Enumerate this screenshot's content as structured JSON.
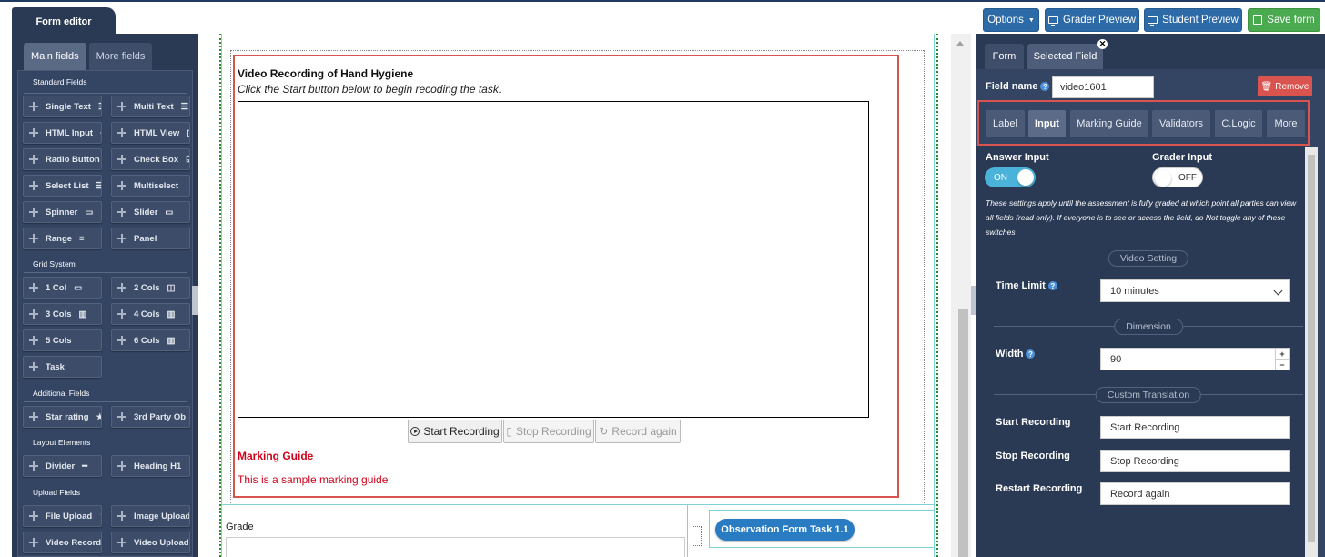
{
  "topbar": {
    "tab_label": "Form editor",
    "options_label": "Options",
    "grader_preview_label": "Grader Preview",
    "student_preview_label": "Student Preview",
    "save_label": "Save form",
    "colors": {
      "blue": "#2c6aa8",
      "green": "#4aaa4f",
      "navy": "#2a3a55"
    }
  },
  "left": {
    "tabs": [
      "Main fields",
      "More fields"
    ],
    "groups": {
      "standard": "Standard Fields",
      "grid": "Grid System",
      "additional": "Additional Fields",
      "layout": "Layout Elements",
      "upload": "Upload Fields"
    },
    "buttons": {
      "single_text": "Single Text",
      "multi_text": "Multi Text",
      "html_input": "HTML Input",
      "html_view": "HTML View",
      "radio_button": "Radio Button",
      "check_box": "Check Box",
      "select_list": "Select List",
      "multiselect": "Multiselect",
      "spinner": "Spinner",
      "slider": "Slider",
      "range": "Range",
      "panel": "Panel",
      "col1": "1 Col",
      "col2": "2 Cols",
      "col3": "3 Cols",
      "col4": "4 Cols",
      "col5": "5 Cols",
      "col6": "6 Cols",
      "task": "Task",
      "star_rating": "Star rating",
      "third_party": "3rd Party Ob",
      "divider": "Divider",
      "heading": "Heading H1",
      "file_upload": "File Upload",
      "image_upload": "Image Upload",
      "video_record": "Video Record",
      "video_upload": "Video Upload"
    }
  },
  "canvas": {
    "field_title": "Video Recording of Hand Hygiene",
    "field_instruction": "Click the Start button below to begin recoding the task.",
    "start_recording": "Start Recording",
    "stop_recording": "Stop Recording",
    "record_again": "Record again",
    "marking_guide_title": "Marking Guide",
    "marking_guide_text": "This is a sample marking guide",
    "grade_label": "Grade",
    "observation_button": "Observation Form Task 1.1",
    "accent_red": "#d0021b"
  },
  "right": {
    "tabs": [
      "Form",
      "Selected Field"
    ],
    "field_name_label": "Field name",
    "field_name_value": "video1601",
    "remove_label": "Remove",
    "subtabs": [
      "Label",
      "Input",
      "Marking Guide",
      "Validators",
      "C.Logic",
      "More"
    ],
    "answer_input_label": "Answer Input",
    "answer_input_state": "ON",
    "grader_input_label": "Grader Input",
    "grader_input_state": "OFF",
    "note": "These settings apply until the assessment is fully graded at which point all parties can view all fields (read only). If everyone is to see or access the field, do Not toggle any of these switches",
    "video_setting_label": "Video Setting",
    "time_limit_label": "Time Limit",
    "time_limit_value": "10 minutes",
    "dimension_label": "Dimension",
    "width_label": "Width",
    "width_value": "90",
    "custom_translation_label": "Custom Translation",
    "start_recording_label": "Start Recording",
    "start_recording_value": "Start Recording",
    "stop_recording_label": "Stop Recording",
    "stop_recording_value": "Stop Recording",
    "restart_recording_label": "Restart Recording",
    "restart_recording_value": "Record again"
  }
}
